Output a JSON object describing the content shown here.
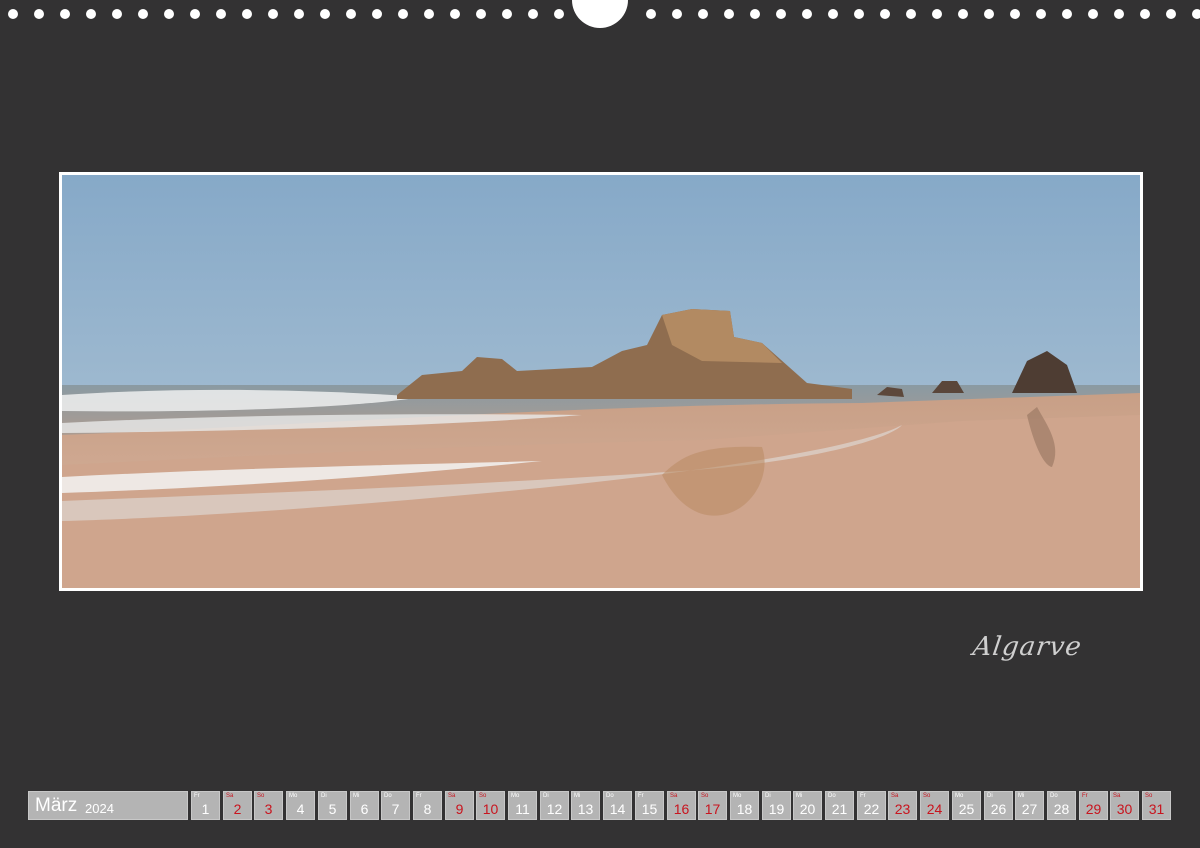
{
  "calendar": {
    "month": "März",
    "year": "2024",
    "days": [
      {
        "n": "1",
        "wd": "Fr",
        "we": false
      },
      {
        "n": "2",
        "wd": "Sa",
        "we": true
      },
      {
        "n": "3",
        "wd": "So",
        "we": true
      },
      {
        "n": "4",
        "wd": "Mo",
        "we": false
      },
      {
        "n": "5",
        "wd": "Di",
        "we": false
      },
      {
        "n": "6",
        "wd": "Mi",
        "we": false
      },
      {
        "n": "7",
        "wd": "Do",
        "we": false
      },
      {
        "n": "8",
        "wd": "Fr",
        "we": false
      },
      {
        "n": "9",
        "wd": "Sa",
        "we": true
      },
      {
        "n": "10",
        "wd": "So",
        "we": true
      },
      {
        "n": "11",
        "wd": "Mo",
        "we": false
      },
      {
        "n": "12",
        "wd": "Di",
        "we": false
      },
      {
        "n": "13",
        "wd": "Mi",
        "we": false
      },
      {
        "n": "14",
        "wd": "Do",
        "we": false
      },
      {
        "n": "15",
        "wd": "Fr",
        "we": false
      },
      {
        "n": "16",
        "wd": "Sa",
        "we": true
      },
      {
        "n": "17",
        "wd": "So",
        "we": true
      },
      {
        "n": "18",
        "wd": "Mo",
        "we": false
      },
      {
        "n": "19",
        "wd": "Di",
        "we": false
      },
      {
        "n": "20",
        "wd": "Mi",
        "we": false
      },
      {
        "n": "21",
        "wd": "Do",
        "we": false
      },
      {
        "n": "22",
        "wd": "Fr",
        "we": false
      },
      {
        "n": "23",
        "wd": "Sa",
        "we": true
      },
      {
        "n": "24",
        "wd": "So",
        "we": true
      },
      {
        "n": "25",
        "wd": "Mo",
        "we": false
      },
      {
        "n": "26",
        "wd": "Di",
        "we": false
      },
      {
        "n": "27",
        "wd": "Mi",
        "we": false
      },
      {
        "n": "28",
        "wd": "Do",
        "we": false
      },
      {
        "n": "29",
        "wd": "Fr",
        "we": true
      },
      {
        "n": "30",
        "wd": "Sa",
        "we": true
      },
      {
        "n": "31",
        "wd": "So",
        "we": true
      }
    ]
  },
  "caption": "Algarve",
  "colors": {
    "background": "#333233",
    "cell": "#b4b4b4",
    "weekend_text": "#c8141e",
    "text": "#ffffff"
  }
}
